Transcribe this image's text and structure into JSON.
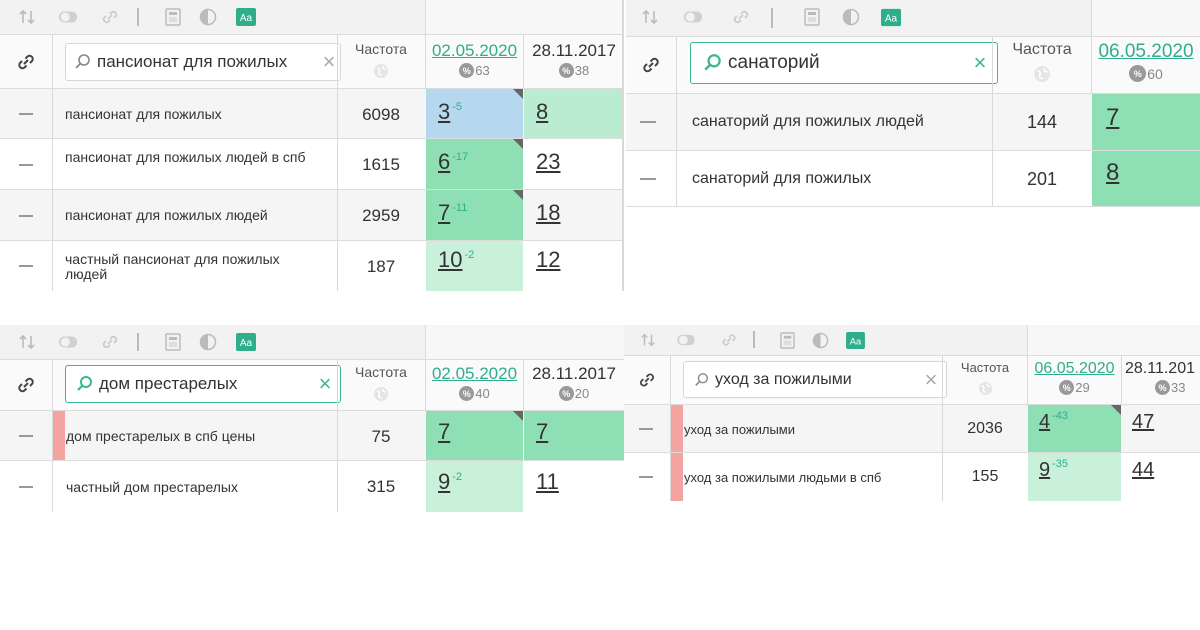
{
  "colors": {
    "accent": "#2fae8c",
    "pos_green_dark": "#8fdfb5",
    "pos_green": "#c9f1da",
    "pos_blue": "#b6d8ef",
    "red_marker": "#f3a3a0"
  },
  "toolbar_icons": [
    "sort-icon",
    "toggle-icon",
    "link-icon",
    "divider",
    "calculator-icon",
    "contrast-icon",
    "text-format-icon"
  ],
  "panels": [
    {
      "search": {
        "value": "пансионат для пожилых"
      },
      "freq_header": "Частота",
      "dates": [
        {
          "label": "02.05.2020",
          "badge": "63"
        },
        {
          "label": "28.11.2017",
          "badge": "38"
        }
      ],
      "rows": [
        {
          "keyword": "пансионат для пожилых",
          "freq": "6098",
          "pos1": "3",
          "delta1": "-5",
          "pos2": "8"
        },
        {
          "keyword": "пансионат для пожилых людей в спб",
          "freq": "1615",
          "pos1": "6",
          "delta1": "-17",
          "pos2": "23"
        },
        {
          "keyword": "пансионат для пожилых людей",
          "freq": "2959",
          "pos1": "7",
          "delta1": "-11",
          "pos2": "18"
        },
        {
          "keyword": "частный пансионат для пожилых людей",
          "freq": "187",
          "pos1": "10",
          "delta1": "-2",
          "pos2": "12"
        }
      ]
    },
    {
      "search": {
        "value": "санаторий"
      },
      "freq_header": "Частота",
      "dates": [
        {
          "label": "06.05.2020",
          "badge": "60"
        }
      ],
      "rows": [
        {
          "keyword": "санаторий для пожилых людей",
          "freq": "144",
          "pos1": "7"
        },
        {
          "keyword": "санаторий для пожилых",
          "freq": "201",
          "pos1": "8"
        }
      ]
    },
    {
      "search": {
        "value": "дом престарелых"
      },
      "freq_header": "Частота",
      "dates": [
        {
          "label": "02.05.2020",
          "badge": "40"
        },
        {
          "label": "28.11.2017",
          "badge": "20"
        }
      ],
      "rows": [
        {
          "keyword": "дом престарелых в спб цены",
          "freq": "75",
          "pos1": "7",
          "pos2": "7"
        },
        {
          "keyword": "частный дом престарелых",
          "freq": "315",
          "pos1": "9",
          "delta1": "-2",
          "pos2": "11"
        }
      ]
    },
    {
      "search": {
        "value": "уход за пожилыми"
      },
      "freq_header": "Частота",
      "dates": [
        {
          "label": "06.05.2020",
          "badge": "29"
        },
        {
          "label": "28.11.201",
          "badge": "33"
        }
      ],
      "rows": [
        {
          "keyword": "уход за пожилыми",
          "freq": "2036",
          "pos1": "4",
          "delta1": "-43",
          "pos2": "47"
        },
        {
          "keyword": "уход за пожилыми людьми в спб",
          "freq": "155",
          "pos1": "9",
          "delta1": "-35",
          "pos2": "44"
        }
      ]
    }
  ]
}
